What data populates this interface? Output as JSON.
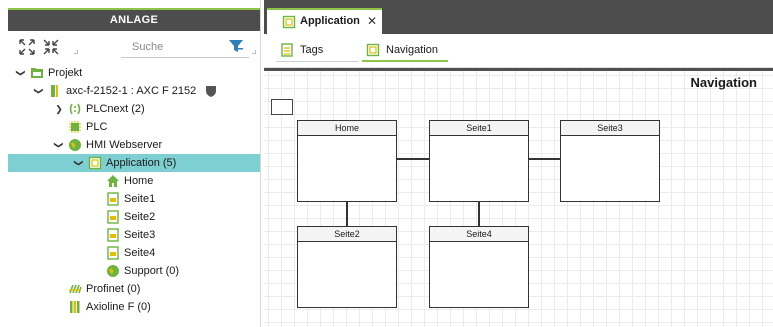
{
  "left_panel": {
    "title": "ANLAGE",
    "search_placeholder": "Suche"
  },
  "tree": {
    "projekt": "Projekt",
    "device": "axc-f-2152-1 : AXC F 2152",
    "plcnext": "PLCnext (2)",
    "plc": "PLC",
    "hmi": "HMI Webserver",
    "application": "Application (5)",
    "home": "Home",
    "seite1": "Seite1",
    "seite2": "Seite2",
    "seite3": "Seite3",
    "seite4": "Seite4",
    "support": "Support (0)",
    "profinet": "Profinet (0)",
    "axioline": "Axioline F (0)"
  },
  "tabs": {
    "main": "Application",
    "close": "✕",
    "sub_tags": "Tags",
    "sub_navigation": "Navigation"
  },
  "canvas": {
    "title": "Navigation",
    "pages": {
      "home": "Home",
      "seite1": "Seite1",
      "seite3": "Seite3",
      "seite2": "Seite2",
      "seite4": "Seite4"
    }
  },
  "colors": {
    "accent_green": "#8ec549",
    "selection": "#7ecfd1",
    "header_dark": "#4d4d4d",
    "icon_green": "#6db33f",
    "icon_yellow": "#e0c000"
  }
}
